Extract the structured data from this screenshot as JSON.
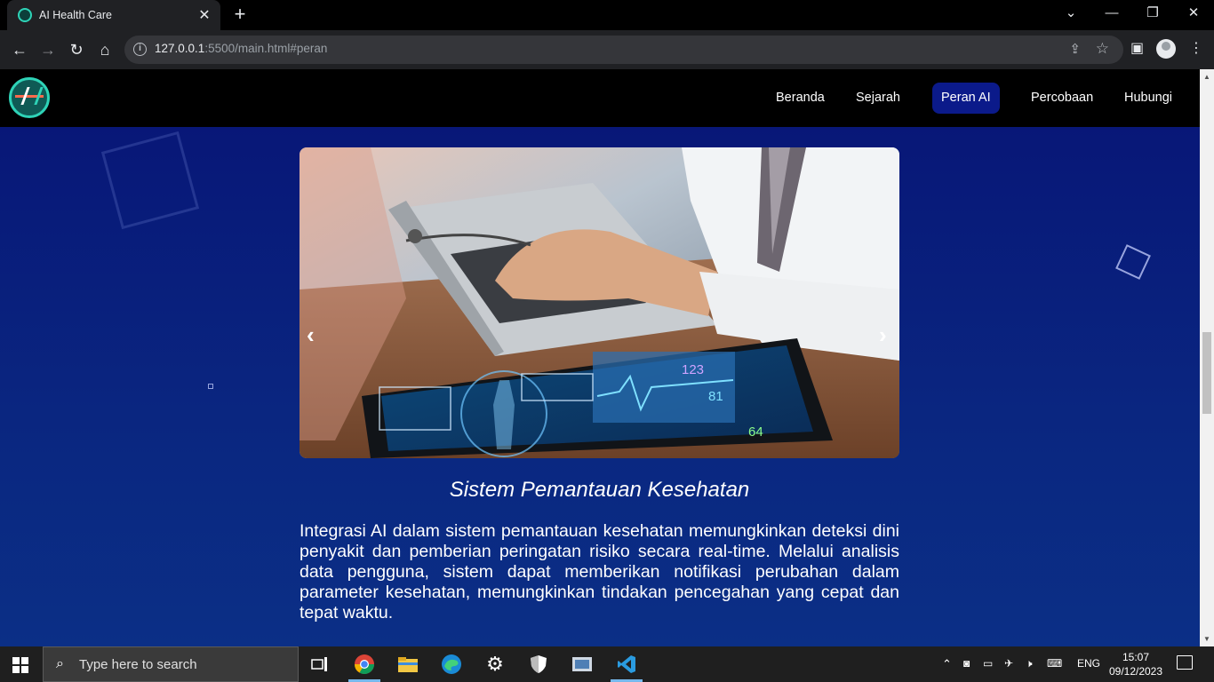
{
  "browser": {
    "tab_title": "AI Health Care",
    "url_host": "127.0.0.1",
    "url_rest": ":5500/main.html#peran"
  },
  "site": {
    "nav": [
      "Beranda",
      "Sejarah",
      "Peran AI",
      "Percobaan",
      "Hubungi"
    ],
    "active_nav": "Peran AI"
  },
  "carousel": {
    "prev_label": "‹",
    "next_label": "›",
    "tablet_numbers": [
      "123",
      "81",
      "64"
    ]
  },
  "section": {
    "title": "Sistem Pemantauan Kesehatan",
    "text": "Integrasi AI dalam sistem pemantauan kesehatan memungkinkan deteksi dini penyakit dan pemberian peringatan risiko secara real-time. Melalui analisis data pengguna, sistem dapat memberikan notifikasi perubahan dalam parameter kesehatan, memungkinkan tindakan pencegahan yang cepat dan tepat waktu."
  },
  "taskbar": {
    "search_placeholder": "Type here to search",
    "language": "ENG",
    "time": "15:07",
    "date": "09/12/2023"
  },
  "colors": {
    "page_bg": "#071476",
    "active_nav_bg": "#0b1a8a",
    "accent": "#2ed3b7"
  }
}
